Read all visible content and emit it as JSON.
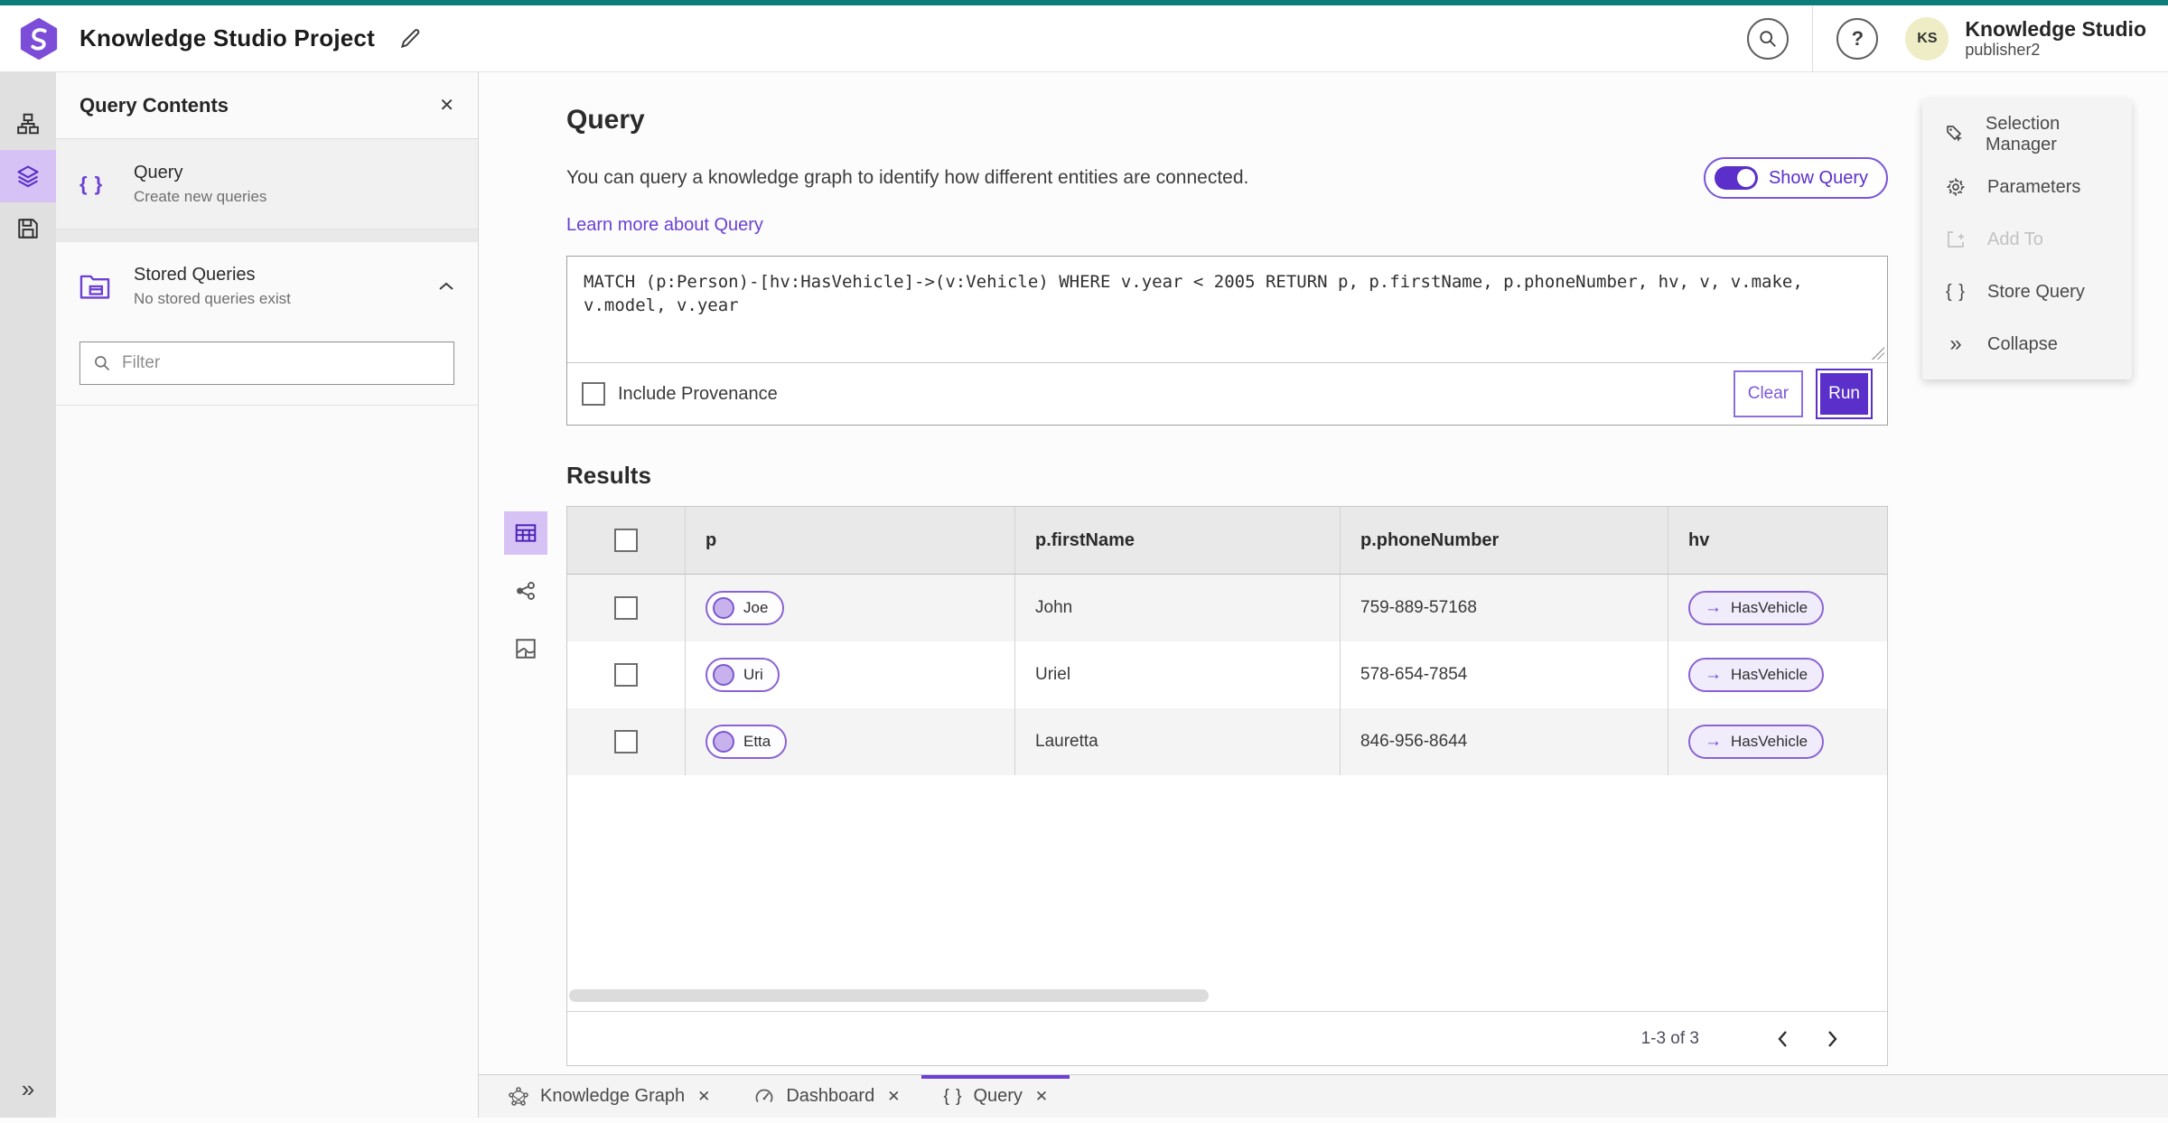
{
  "header": {
    "title": "Knowledge Studio Project",
    "product": "Knowledge Studio",
    "username": "publisher2",
    "avatar_initials": "KS"
  },
  "glyphs": {
    "braces": "{ }",
    "collapse": "»",
    "arrow_right": "→",
    "close": "✕",
    "question": "?"
  },
  "panel": {
    "title": "Query Contents",
    "query_item": {
      "title": "Query",
      "subtitle": "Create new queries"
    },
    "stored_item": {
      "title": "Stored Queries",
      "subtitle": "No stored queries exist"
    },
    "filter_placeholder": "Filter"
  },
  "query_section": {
    "heading": "Query",
    "description": "You can query a knowledge graph to identify how different entities are connected.",
    "learn_link": "Learn more about Query",
    "show_query_label": "Show Query",
    "query_text": "MATCH (p:Person)-[hv:HasVehicle]->(v:Vehicle) WHERE v.year < 2005 RETURN p, p.firstName, p.phoneNumber, hv, v, v.make, v.model, v.year",
    "include_provenance": "Include Provenance",
    "clear_label": "Clear",
    "run_label": "Run"
  },
  "results": {
    "heading": "Results",
    "columns": [
      "p",
      "p.firstName",
      "p.phoneNumber",
      "hv"
    ],
    "rows": [
      {
        "p": "Joe",
        "firstName": "John",
        "phoneNumber": "759-889-57168",
        "hv": "HasVehicle"
      },
      {
        "p": "Uri",
        "firstName": "Uriel",
        "phoneNumber": "578-654-7854",
        "hv": "HasVehicle"
      },
      {
        "p": "Etta",
        "firstName": "Lauretta",
        "phoneNumber": "846-956-8644",
        "hv": "HasVehicle"
      }
    ],
    "pagination": "1-3 of 3"
  },
  "right_menu": {
    "items": [
      {
        "label": "Selection Manager"
      },
      {
        "label": "Parameters"
      },
      {
        "label": "Add To"
      },
      {
        "label": "Store Query"
      },
      {
        "label": "Collapse"
      }
    ]
  },
  "tabs": [
    {
      "label": "Knowledge Graph"
    },
    {
      "label": "Dashboard"
    },
    {
      "label": "Query"
    }
  ],
  "colors": {
    "accent": "#6b40d2",
    "accent_deep": "#5b2fc9",
    "teal_top": "#0d7d7a",
    "rail_active_bg": "#d6c2f5",
    "avatar_bg": "#eeedc6"
  }
}
